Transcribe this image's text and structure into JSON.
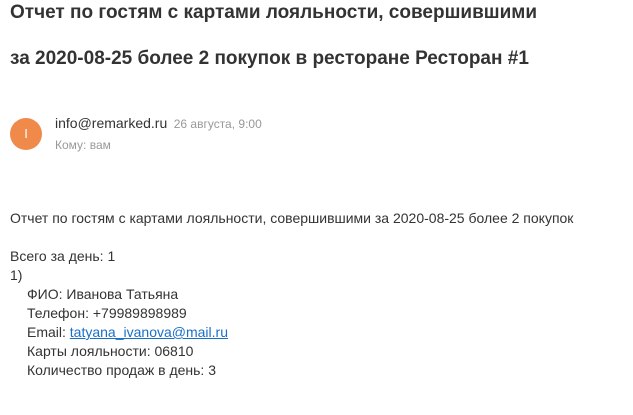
{
  "email": {
    "subject_line1": "Отчет по гостям с картами лояльности, совершившими",
    "subject_line2": "за 2020-08-25 более 2 покупок в ресторане Ресторан #1",
    "avatar_letter": "I",
    "avatar_color": "#f08a4b",
    "sender": "info@remarked.ru",
    "date": "26 августа, 9:00",
    "to": "Кому: вам",
    "body": {
      "intro": "Отчет по гостям с картами лояльности, совершившими за 2020-08-25 более 2 покупок",
      "total": "Всего за день: 1",
      "item_number": "1)",
      "fio": "ФИО: Иванова Татьяна",
      "phone": "Телефон: +79989898989",
      "email_label": "Email: ",
      "email_link": "tatyana_ivanova@mail.ru",
      "cards": "Карты лояльности: 06810",
      "sales": "Количество продаж в день: 3"
    }
  },
  "colors": {
    "text": "#333333",
    "meta": "#999999",
    "link": "#1a6fc6"
  }
}
